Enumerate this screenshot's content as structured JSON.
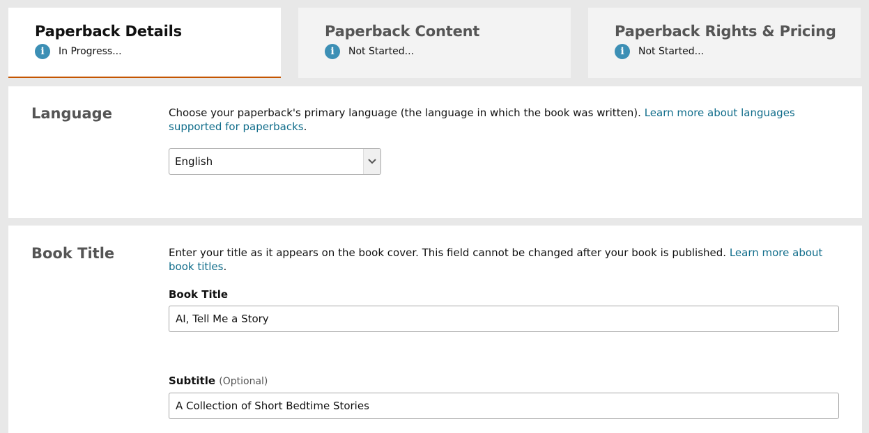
{
  "tabs": [
    {
      "title": "Paperback Details",
      "status": "In Progress..."
    },
    {
      "title": "Paperback Content",
      "status": "Not Started..."
    },
    {
      "title": "Paperback Rights & Pricing",
      "status": "Not Started..."
    }
  ],
  "language": {
    "heading": "Language",
    "description": "Choose your paperback's primary language (the language in which the book was written).",
    "link": "Learn more about languages supported for paperbacks",
    "link_suffix": ".",
    "selected": "English"
  },
  "book_title": {
    "heading": "Book Title",
    "description": "Enter your title as it appears on the book cover. This field cannot be changed after your book is published.",
    "link": "Learn more about book titles",
    "link_suffix": ".",
    "title_label": "Book Title",
    "title_value": "AI, Tell Me a Story",
    "subtitle_label": "Subtitle",
    "subtitle_optional": "(Optional)",
    "subtitle_value": "A Collection of Short Bedtime Stories"
  },
  "colors": {
    "accent_tab_underline": "#c45500",
    "link": "#0f6c8a",
    "info_icon": "#3c8fb5"
  }
}
